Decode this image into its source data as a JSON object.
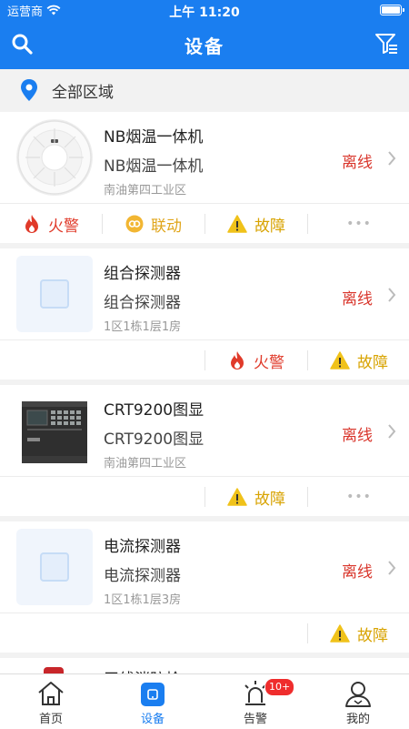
{
  "status_bar": {
    "carrier": "运营商",
    "time": "上午 11:20"
  },
  "header": {
    "title": "设备"
  },
  "region": {
    "label": "全部区域"
  },
  "devices": [
    {
      "name": "NB烟温一体机",
      "subname": "NB烟温一体机",
      "location": "南油第四工业区",
      "status": "离线",
      "actions": {
        "fire": "火警",
        "link": "联动",
        "fault": "故障",
        "more": "•••"
      }
    },
    {
      "name": "组合探测器",
      "subname": "组合探测器",
      "location": "1区1栋1层1房",
      "status": "离线",
      "actions": {
        "fire": "火警",
        "fault": "故障"
      }
    },
    {
      "name": "CRT9200图显",
      "subname": "CRT9200图显",
      "location": "南油第四工业区",
      "status": "离线",
      "actions": {
        "fault": "故障",
        "more": "•••"
      }
    },
    {
      "name": "电流探测器",
      "subname": "电流探测器",
      "location": "1区1栋1层3房",
      "status": "离线",
      "actions": {
        "fault": "故障"
      }
    },
    {
      "name": "无线消防栓",
      "status": ""
    }
  ],
  "tabbar": {
    "tabs": [
      {
        "label": "首页"
      },
      {
        "label": "设备"
      },
      {
        "label": "告警",
        "badge": "10+"
      },
      {
        "label": "我的"
      }
    ],
    "active": "设备"
  },
  "colors": {
    "primary": "#1a7ef0",
    "offline": "#d9362c",
    "fire": "#e03a2a",
    "link": "#e0a51a",
    "fault": "#d8a300"
  }
}
